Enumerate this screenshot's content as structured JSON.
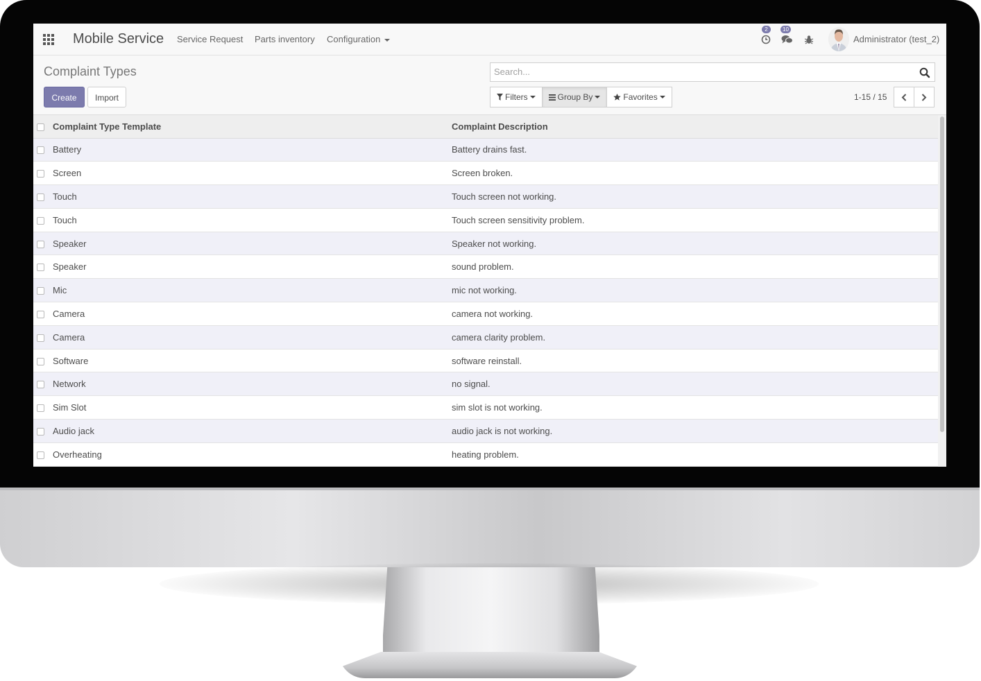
{
  "navbar": {
    "brand": "Mobile Service",
    "menu": [
      "Service Request",
      "Parts inventory",
      "Configuration"
    ],
    "activity_count": "2",
    "message_count": "10",
    "user": "Administrator (test_2)"
  },
  "control_panel": {
    "title": "Complaint Types",
    "create_label": "Create",
    "import_label": "Import",
    "search_placeholder": "Search...",
    "filters_label": "Filters",
    "group_by_label": "Group By",
    "favorites_label": "Favorites",
    "pager": "1-15 / 15"
  },
  "table": {
    "headers": [
      "Complaint Type Template",
      "Complaint Description"
    ],
    "rows": [
      [
        "Battery",
        "Battery drains fast."
      ],
      [
        "Screen",
        "Screen broken."
      ],
      [
        "Touch",
        "Touch screen not working."
      ],
      [
        "Touch",
        "Touch screen sensitivity problem."
      ],
      [
        "Speaker",
        "Speaker not working."
      ],
      [
        "Speaker",
        "sound problem."
      ],
      [
        "Mic",
        "mic not working."
      ],
      [
        "Camera",
        "camera not working."
      ],
      [
        "Camera",
        "camera clarity problem."
      ],
      [
        "Software",
        "software reinstall."
      ],
      [
        "Network",
        "no signal."
      ],
      [
        "Sim Slot",
        "sim slot is not working."
      ],
      [
        "Audio jack",
        "audio jack is not working."
      ],
      [
        "Overheating",
        "heating problem."
      ]
    ]
  },
  "colors": {
    "primary": "#7c7bad",
    "row_alt": "#f0f0f8",
    "navbar_bg": "#f8f8f8"
  }
}
